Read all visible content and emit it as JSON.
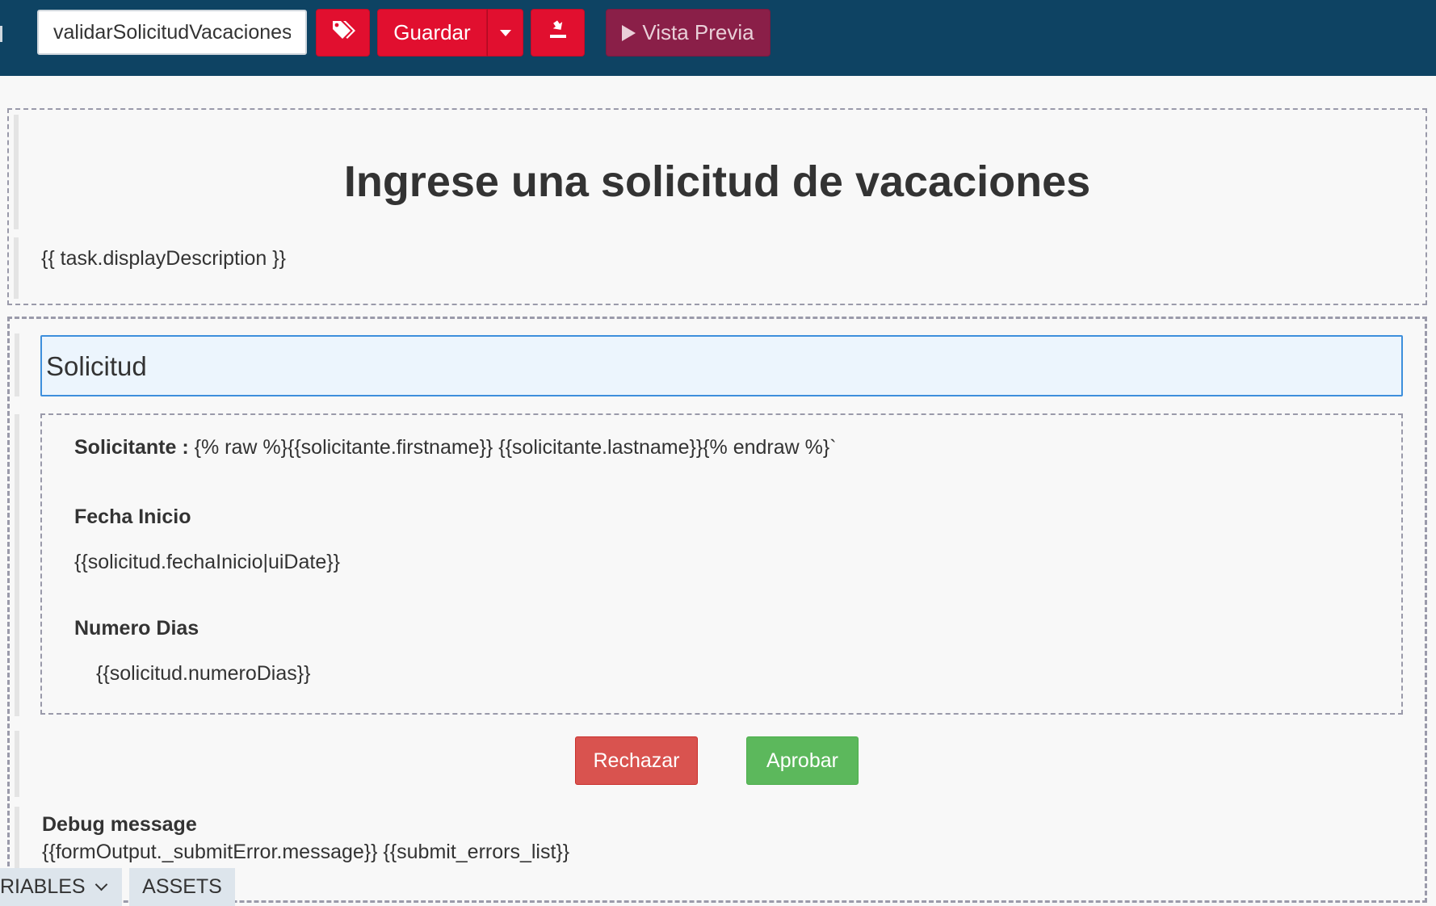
{
  "toolbar": {
    "form_name_value": "validarSolicitudVacaciones",
    "save_label": "Guardar",
    "preview_label": "Vista Previa"
  },
  "header": {
    "title": "Ingrese una solicitud de vacaciones",
    "description": "{{ task.displayDescription }}"
  },
  "form": {
    "panel_title": "Solicitud",
    "requester_label": "Solicitante :",
    "requester_value": " {% raw %}{{solicitante.firstname}} {{solicitante.lastname}}{% endraw %}`",
    "start_date_label": "Fecha Inicio",
    "start_date_value": "{{solicitud.fechaInicio|uiDate}}",
    "days_label": "Numero Dias",
    "days_value": "{{solicitud.numeroDias}}",
    "reject_label": "Rechazar",
    "approve_label": "Aprobar",
    "debug_label": "Debug message",
    "debug_value": "{{formOutput._submitError.message}} {{submit_errors_list}}"
  },
  "bottom_tabs": {
    "variables_label": "RIABLES",
    "assets_label": "ASSETS"
  },
  "icons": {
    "tags": "tags-icon",
    "caret": "caret-down-icon",
    "export": "export-icon",
    "play": "play-icon",
    "chevron": "chevron-down-icon"
  },
  "colors": {
    "toolbar_bg": "#0e4363",
    "primary_red": "#e10f2f",
    "preview_bg": "#8a1f48",
    "reject": "#d9534f",
    "approve": "#5cb85c",
    "panel_border": "#3d8fdc",
    "panel_bg": "#ecf5fd"
  }
}
